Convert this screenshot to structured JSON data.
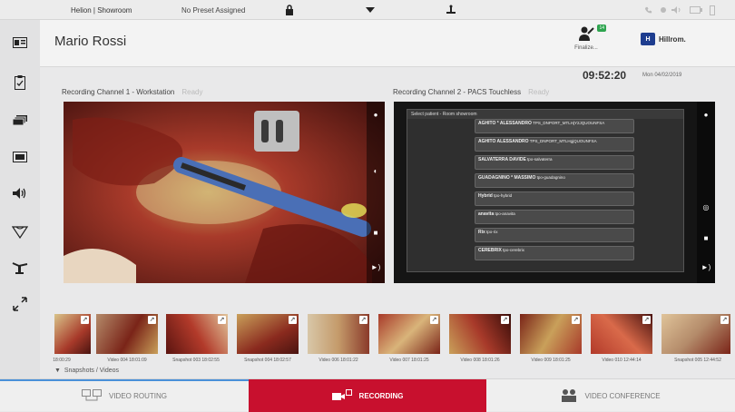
{
  "topbar": {
    "app_title": "Helion | Showroom",
    "preset": "No Preset Assigned"
  },
  "header": {
    "patient_name": "Mario Rossi",
    "finalize_label": "Finalize...",
    "finalize_badge": "14",
    "brand": "Hillrom.",
    "brand_mark": "H",
    "time": "09:52:20",
    "date": "Mon 04/02/2019"
  },
  "channel1": {
    "title": "Recording Channel 1 - Workstation",
    "state": "Ready"
  },
  "channel2": {
    "title": "Recording Channel 2 - PACS Touchless",
    "state": "Ready",
    "pacs": {
      "header": "Select patient - Room showroom",
      "rows": [
        {
          "name": "AGHITO * ALESSANDRO",
          "detail": "TPS_DNPORT_MTLHjY2JQUOUNFSA"
        },
        {
          "name": "AGHITO ALESSANDRO",
          "detail": "TPS_DNPORT_MTLHgjQUOUNFSA"
        },
        {
          "name": "SALVATERRA DAVIDE",
          "detail": "tpo-salvaterra"
        },
        {
          "name": "GUADAGNINO * MASSIMO",
          "detail": "tpo-guadagnino"
        },
        {
          "name": "Hybrid",
          "detail": "tpo-hybrid"
        },
        {
          "name": "anavita",
          "detail": "tpo-anavita"
        },
        {
          "name": "Rix",
          "detail": "tpo-rix"
        },
        {
          "name": "CEREBRIX",
          "detail": "tpo-cerebrix"
        }
      ]
    }
  },
  "snapshots": {
    "title": "Snapshots / Videos",
    "items": [
      {
        "label": "18:00:29"
      },
      {
        "label": "Video 004 18:01:09"
      },
      {
        "label": "Snapshot 003 18:02:55"
      },
      {
        "label": "Snapshot 004 18:02:57"
      },
      {
        "label": "Video 006 18:01:22"
      },
      {
        "label": "Video 007 18:01:25"
      },
      {
        "label": "Video 008 18:01:26"
      },
      {
        "label": "Video 009 18:01:25"
      },
      {
        "label": "Video 010 12:44:14"
      },
      {
        "label": "Snapshot 005 12:44:52"
      }
    ]
  },
  "bottombar": {
    "tabs": [
      {
        "label": "VIDEO ROUTING"
      },
      {
        "label": "RECORDING"
      },
      {
        "label": "VIDEO CONFERENCE"
      }
    ]
  },
  "colors": {
    "accent_red": "#c8102e",
    "brand_blue": "#1e3d8f",
    "badge_green": "#2ea44f"
  }
}
